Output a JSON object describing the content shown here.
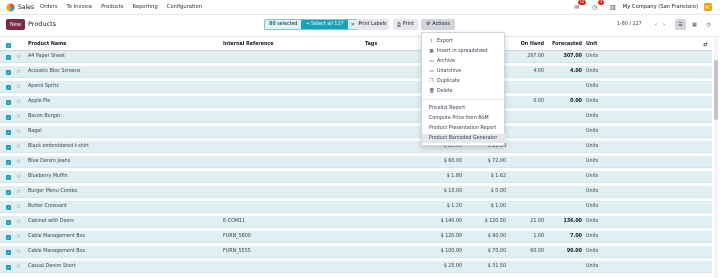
{
  "nav": {
    "app_name": "Sales",
    "menu": [
      "Orders",
      "To Invoice",
      "Products",
      "Reporting",
      "Configuration"
    ],
    "messages_badge": "10",
    "activity_badge": "3",
    "company": "My Company (San Francisco)",
    "company_initials": "MC"
  },
  "control": {
    "new_label": "New",
    "title": "Products",
    "selected_count": "80",
    "selected_label": "selected",
    "select_all_label": "Select all 127",
    "print_labels": "Print Labels",
    "print": "Print",
    "actions": "Actions",
    "pager": "1-80 / 127"
  },
  "table": {
    "headers": {
      "name": "Product Name",
      "ref": "Internal Reference",
      "tags": "Tags",
      "onhand": "On Hand",
      "forecasted": "Forecasted",
      "unit": "Unit"
    },
    "rows": [
      {
        "name": "A4 Paper Sheet",
        "ref": "",
        "sale": "",
        "cost": "",
        "onhand": "297.00",
        "fore": "307.00",
        "fore_bold": true,
        "unit": "Units"
      },
      {
        "name": "Acoustic Bloc Screens",
        "ref": "",
        "sale": "",
        "cost": "",
        "onhand": "4.00",
        "fore": "4.00",
        "fore_bold": true,
        "unit": "Units"
      },
      {
        "name": "Aperol Spritz",
        "ref": "",
        "sale": "",
        "cost": "",
        "onhand": "",
        "fore": "",
        "fore_bold": false,
        "unit": "Units"
      },
      {
        "name": "Apple Pie",
        "ref": "",
        "sale": "",
        "cost": "",
        "onhand": "0.00",
        "fore": "0.00",
        "fore_bold": true,
        "unit": "Units"
      },
      {
        "name": "Bacon Burger",
        "ref": "",
        "sale": "",
        "cost": "",
        "onhand": "",
        "fore": "",
        "fore_bold": false,
        "unit": "Units"
      },
      {
        "name": "Bagel",
        "ref": "",
        "sale": "",
        "cost": "",
        "onhand": "",
        "fore": "",
        "fore_bold": false,
        "unit": "Units"
      },
      {
        "name": "Black embroidered t-shirt",
        "ref": "",
        "sale": "$ 25.00",
        "cost": "$ 22.50",
        "onhand": "",
        "fore": "",
        "fore_bold": false,
        "unit": "Units"
      },
      {
        "name": "Blue Denim Jeans",
        "ref": "",
        "sale": "$ 60.00",
        "cost": "$ 72.00",
        "onhand": "",
        "fore": "",
        "fore_bold": false,
        "unit": "Units"
      },
      {
        "name": "Blueberry Muffin",
        "ref": "",
        "sale": "$ 1.80",
        "cost": "$ 1.62",
        "onhand": "",
        "fore": "",
        "fore_bold": false,
        "unit": "Units"
      },
      {
        "name": "Burger Menu Combo",
        "ref": "",
        "sale": "$ 10.00",
        "cost": "$ 0.00",
        "onhand": "",
        "fore": "",
        "fore_bold": false,
        "unit": "Units"
      },
      {
        "name": "Butter Croissant",
        "ref": "",
        "sale": "$ 1.20",
        "cost": "$ 1.00",
        "onhand": "",
        "fore": "",
        "fore_bold": false,
        "unit": "Units"
      },
      {
        "name": "Cabinet with Doors",
        "ref": "E-COM11",
        "sale": "$ 140.00",
        "cost": "$ 120.50",
        "onhand": "21.00",
        "fore": "136.00",
        "fore_bold": true,
        "unit": "Units"
      },
      {
        "name": "Cable Management Box",
        "ref": "FURN_5800",
        "sale": "$ 120.00",
        "cost": "$ 90.00",
        "onhand": "1.00",
        "fore": "7.00",
        "fore_bold": true,
        "unit": "Units"
      },
      {
        "name": "Cable Management Box",
        "ref": "FURN_5555",
        "sale": "$ 100.00",
        "cost": "$ 70.00",
        "onhand": "60.00",
        "fore": "90.00",
        "fore_bold": true,
        "unit": "Units"
      },
      {
        "name": "Casual Denim Short",
        "ref": "",
        "sale": "$ 25.00",
        "cost": "$ 31.50",
        "onhand": "",
        "fore": "",
        "fore_bold": false,
        "unit": "Units"
      }
    ]
  },
  "dropdown": {
    "items": [
      {
        "icon": "upload-icon",
        "glyph": "⇪",
        "label": "Export"
      },
      {
        "icon": "spreadsheet-icon",
        "glyph": "▦",
        "label": "Insert in spreadsheet"
      },
      {
        "icon": "archive-icon",
        "glyph": "▭",
        "label": "Archive"
      },
      {
        "icon": "unarchive-icon",
        "glyph": "▭",
        "label": "Unarchive"
      },
      {
        "icon": "duplicate-icon",
        "glyph": "❐",
        "label": "Duplicate"
      },
      {
        "icon": "trash-icon",
        "glyph": "🗑",
        "label": "Delete"
      }
    ],
    "reports": [
      "Pricelist Report",
      "Compute Price from BoM",
      "Product Presentation Report",
      "Product Barcoded Generator"
    ]
  },
  "colors": {
    "brand": "#7b2a4a",
    "accent": "#17a2b8",
    "selected_row": "#e0eff2"
  }
}
